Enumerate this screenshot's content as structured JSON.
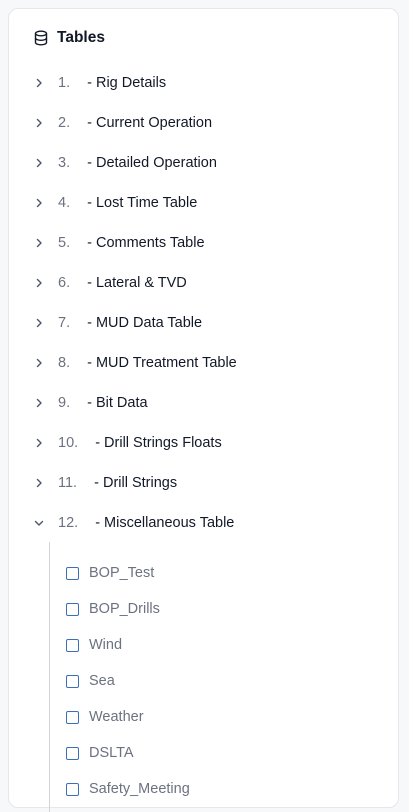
{
  "header": {
    "icon": "database-icon",
    "title": "Tables"
  },
  "colors": {
    "checkbox_border": "#3b6fb6",
    "text_primary": "#111827",
    "text_muted": "#6b7280"
  },
  "tables": [
    {
      "num": "1.",
      "label": " - Rig Details",
      "expanded": false
    },
    {
      "num": "2.",
      "label": " - Current Operation",
      "expanded": false
    },
    {
      "num": "3.",
      "label": " - Detailed Operation",
      "expanded": false
    },
    {
      "num": "4.",
      "label": " - Lost Time Table",
      "expanded": false
    },
    {
      "num": "5.",
      "label": " - Comments Table",
      "expanded": false
    },
    {
      "num": "6.",
      "label": " - Lateral & TVD",
      "expanded": false
    },
    {
      "num": "7.",
      "label": " - MUD Data Table",
      "expanded": false
    },
    {
      "num": "8.",
      "label": " - MUD Treatment Table",
      "expanded": false
    },
    {
      "num": "9.",
      "label": " - Bit Data",
      "expanded": false
    },
    {
      "num": "10.",
      "label": " - Drill Strings Floats",
      "expanded": false
    },
    {
      "num": "11.",
      "label": " - Drill Strings",
      "expanded": false
    },
    {
      "num": "12.",
      "label": " - Miscellaneous Table",
      "expanded": true
    }
  ],
  "misc_fields": [
    {
      "label": "BOP_Test",
      "checked": false
    },
    {
      "label": "BOP_Drills",
      "checked": false
    },
    {
      "label": "Wind",
      "checked": false
    },
    {
      "label": "Sea",
      "checked": false
    },
    {
      "label": "Weather",
      "checked": false
    },
    {
      "label": "DSLTA",
      "checked": false
    },
    {
      "label": "Safety_Meeting",
      "checked": false
    }
  ]
}
